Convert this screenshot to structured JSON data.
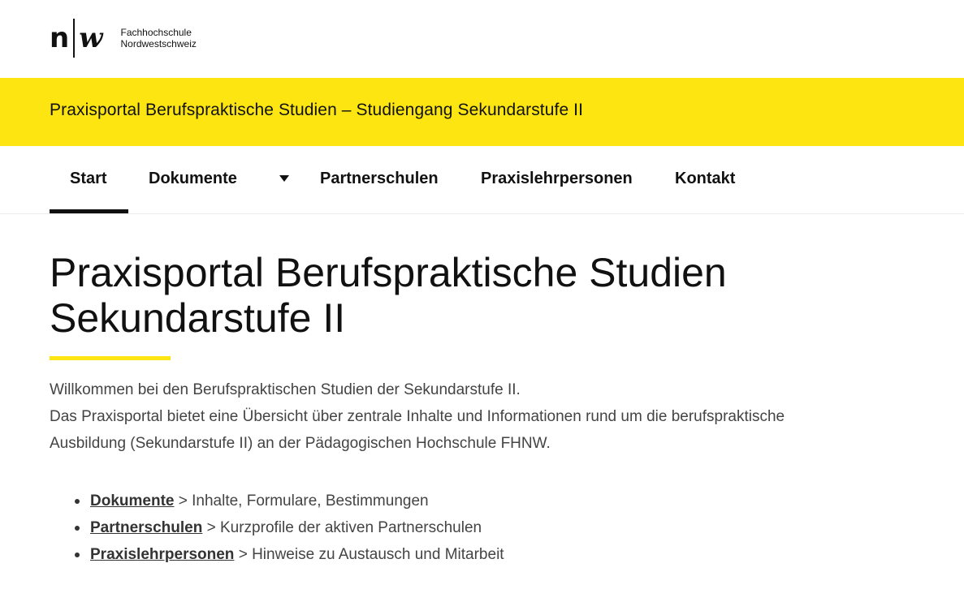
{
  "logo": {
    "letter_n": "n",
    "letter_w": "w",
    "line1": "Fachhochschule",
    "line2": "Nordwestschweiz"
  },
  "banner": {
    "title": "Praxisportal Berufspraktische Studien – Studiengang Sekundarstufe II"
  },
  "nav": {
    "items": [
      {
        "label": "Start",
        "active": true
      },
      {
        "label": "Dokumente",
        "has_dropdown": true
      },
      {
        "label": "Partnerschulen"
      },
      {
        "label": "Praxislehrpersonen"
      },
      {
        "label": "Kontakt"
      }
    ]
  },
  "main": {
    "title_line1": "Praxisportal Berufspraktische Studien",
    "title_line2": "Sekundarstufe II",
    "intro_line1": "Willkommen bei den Berufspraktischen Studien der Sekundarstufe II.",
    "intro_line2": "Das Praxisportal bietet eine Übersicht über zentrale Inhalte und Informationen rund um die berufspraktische Ausbildung (Sekundarstufe II) an der Pädagogischen Hochschule FHNW.",
    "links": [
      {
        "link": "Dokumente",
        "text": " > Inhalte, Formulare, Bestimmungen"
      },
      {
        "link": "Partnerschulen",
        "text": " > Kurzprofile der aktiven Partnerschulen"
      },
      {
        "link": "Praxislehrpersonen",
        "text": " > Hinweise zu Austausch und Mitarbeit"
      }
    ]
  },
  "colors": {
    "accent_yellow": "#fde511",
    "text_dark": "#111111",
    "text_body": "#444444"
  }
}
